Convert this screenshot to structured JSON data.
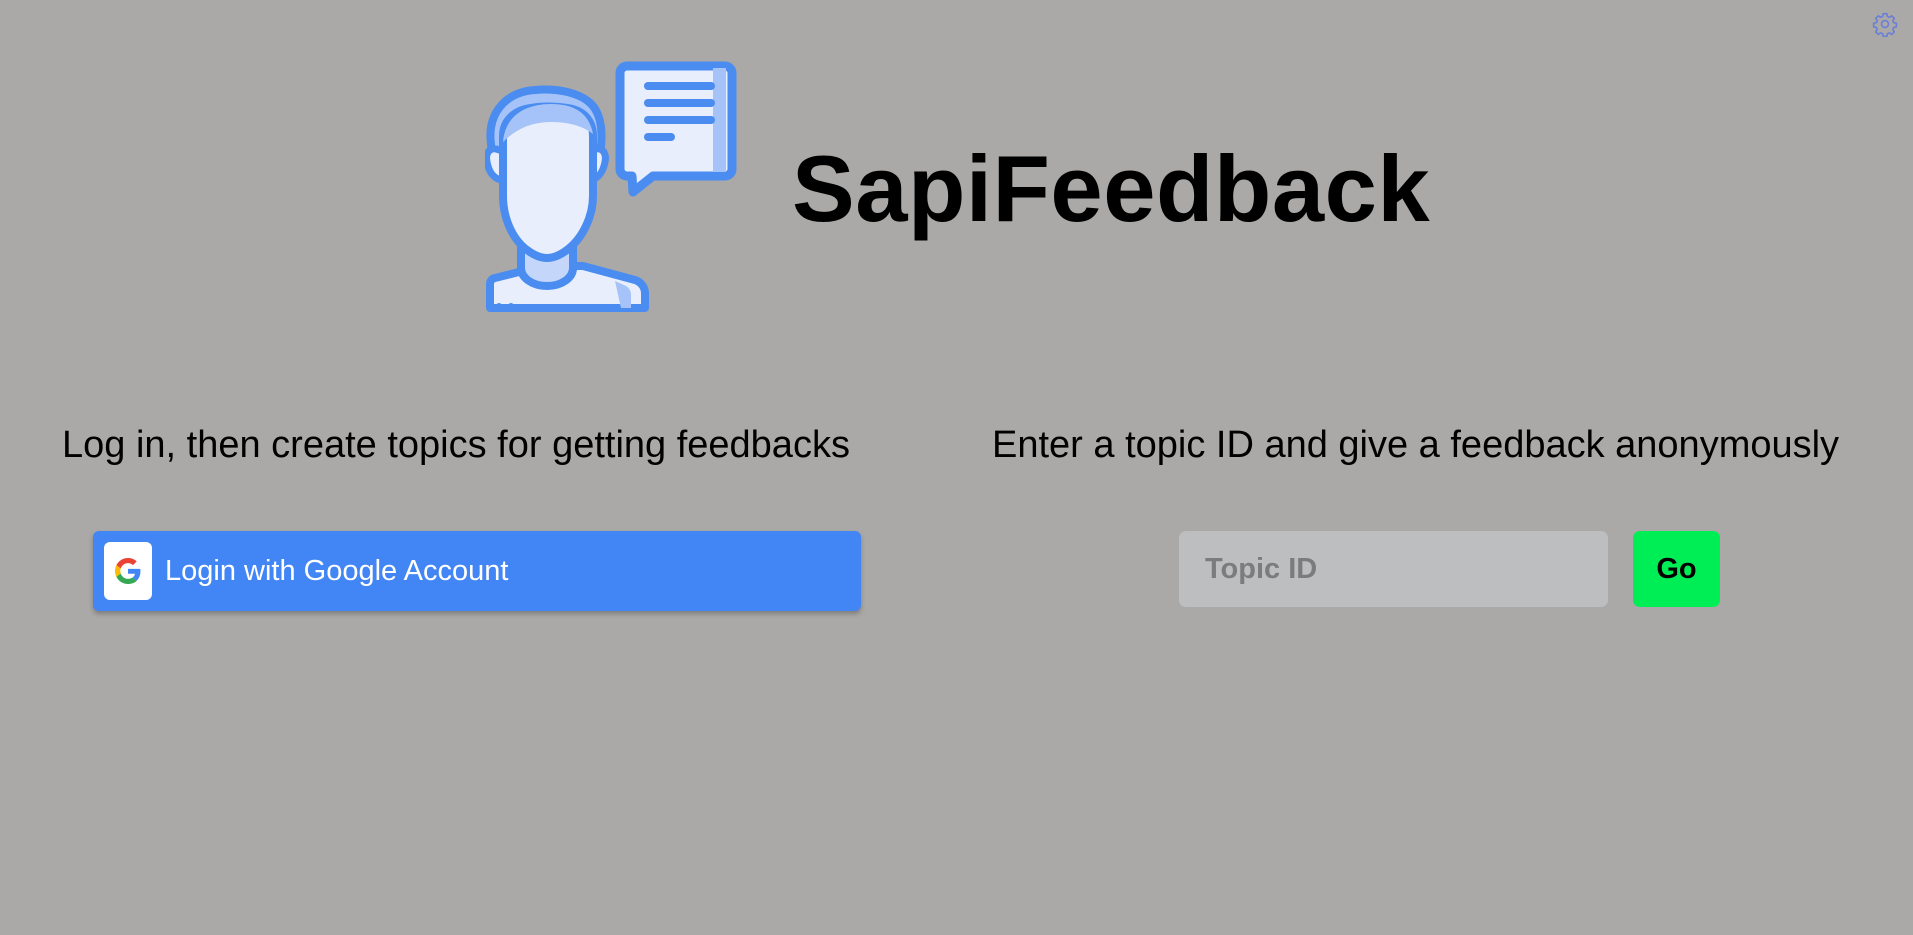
{
  "app": {
    "title": "SapiFeedback"
  },
  "icons": {
    "settings": "gear-icon",
    "logo": "person-with-speech-bubble-icon",
    "google": "google-g-icon"
  },
  "colors": {
    "background": "#aaa9a7",
    "google_button": "#4285f4",
    "go_button": "#00ee55",
    "input_background": "#bdbebf",
    "logo_accent": "#4a8cf0"
  },
  "left_panel": {
    "heading": "Log in, then create topics for getting feedbacks",
    "login_button_label": "Login with Google Account"
  },
  "right_panel": {
    "heading": "Enter a topic ID and give a feedback anonymously",
    "topic_input": {
      "placeholder": "Topic ID",
      "value": ""
    },
    "go_button_label": "Go"
  }
}
